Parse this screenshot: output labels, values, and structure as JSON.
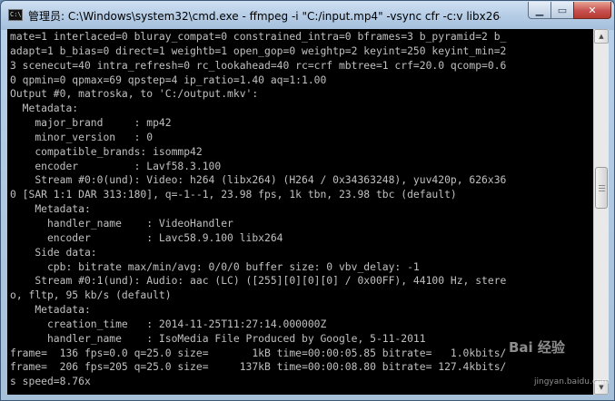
{
  "window": {
    "title": "管理员: C:\\Windows\\system32\\cmd.exe - ffmpeg  -i \"C:/input.mp4\" -vsync cfr -c:v libx264 -...",
    "icon": "console-icon",
    "controls": {
      "minimize": "minimize-icon",
      "maximize": "maximize-icon",
      "close": "close-icon"
    }
  },
  "console": {
    "lines": [
      "mate=1 interlaced=0 bluray_compat=0 constrained_intra=0 bframes=3 b_pyramid=2 b_",
      "adapt=1 b_bias=0 direct=1 weightb=1 open_gop=0 weightp=2 keyint=250 keyint_min=2",
      "3 scenecut=40 intra_refresh=0 rc_lookahead=40 rc=crf mbtree=1 crf=20.0 qcomp=0.6",
      "0 qpmin=0 qpmax=69 qpstep=4 ip_ratio=1.40 aq=1:1.00",
      "Output #0, matroska, to 'C:/output.mkv':",
      "  Metadata:",
      "    major_brand     : mp42",
      "    minor_version   : 0",
      "    compatible_brands: isommp42",
      "    encoder         : Lavf58.3.100",
      "    Stream #0:0(und): Video: h264 (libx264) (H264 / 0x34363248), yuv420p, 626x36",
      "0 [SAR 1:1 DAR 313:180], q=-1--1, 23.98 fps, 1k tbn, 23.98 tbc (default)",
      "    Metadata:",
      "      handler_name    : VideoHandler",
      "      encoder         : Lavc58.9.100 libx264",
      "    Side data:",
      "      cpb: bitrate max/min/avg: 0/0/0 buffer size: 0 vbv_delay: -1",
      "    Stream #0:1(und): Audio: aac (LC) ([255][0][0][0] / 0x00FF), 44100 Hz, stere",
      "o, fltp, 95 kb/s (default)",
      "    Metadata:",
      "      creation_time   : 2014-11-25T11:27:14.000000Z",
      "      handler_name    : IsoMedia File Produced by Google, 5-11-2011",
      "frame=  136 fps=0.0 q=25.0 size=       1kB time=00:00:05.85 bitrate=   1.0kbits/",
      "frame=  206 fps=205 q=25.0 size=     137kB time=00:00:08.80 bitrate= 127.4kbits/",
      "s speed=8.76x"
    ]
  },
  "scrollbar": {
    "up_glyph": "▲",
    "down_glyph": "▼"
  },
  "watermark": {
    "text": "Bai 经验",
    "url": "jingyan.baidu.com"
  }
}
